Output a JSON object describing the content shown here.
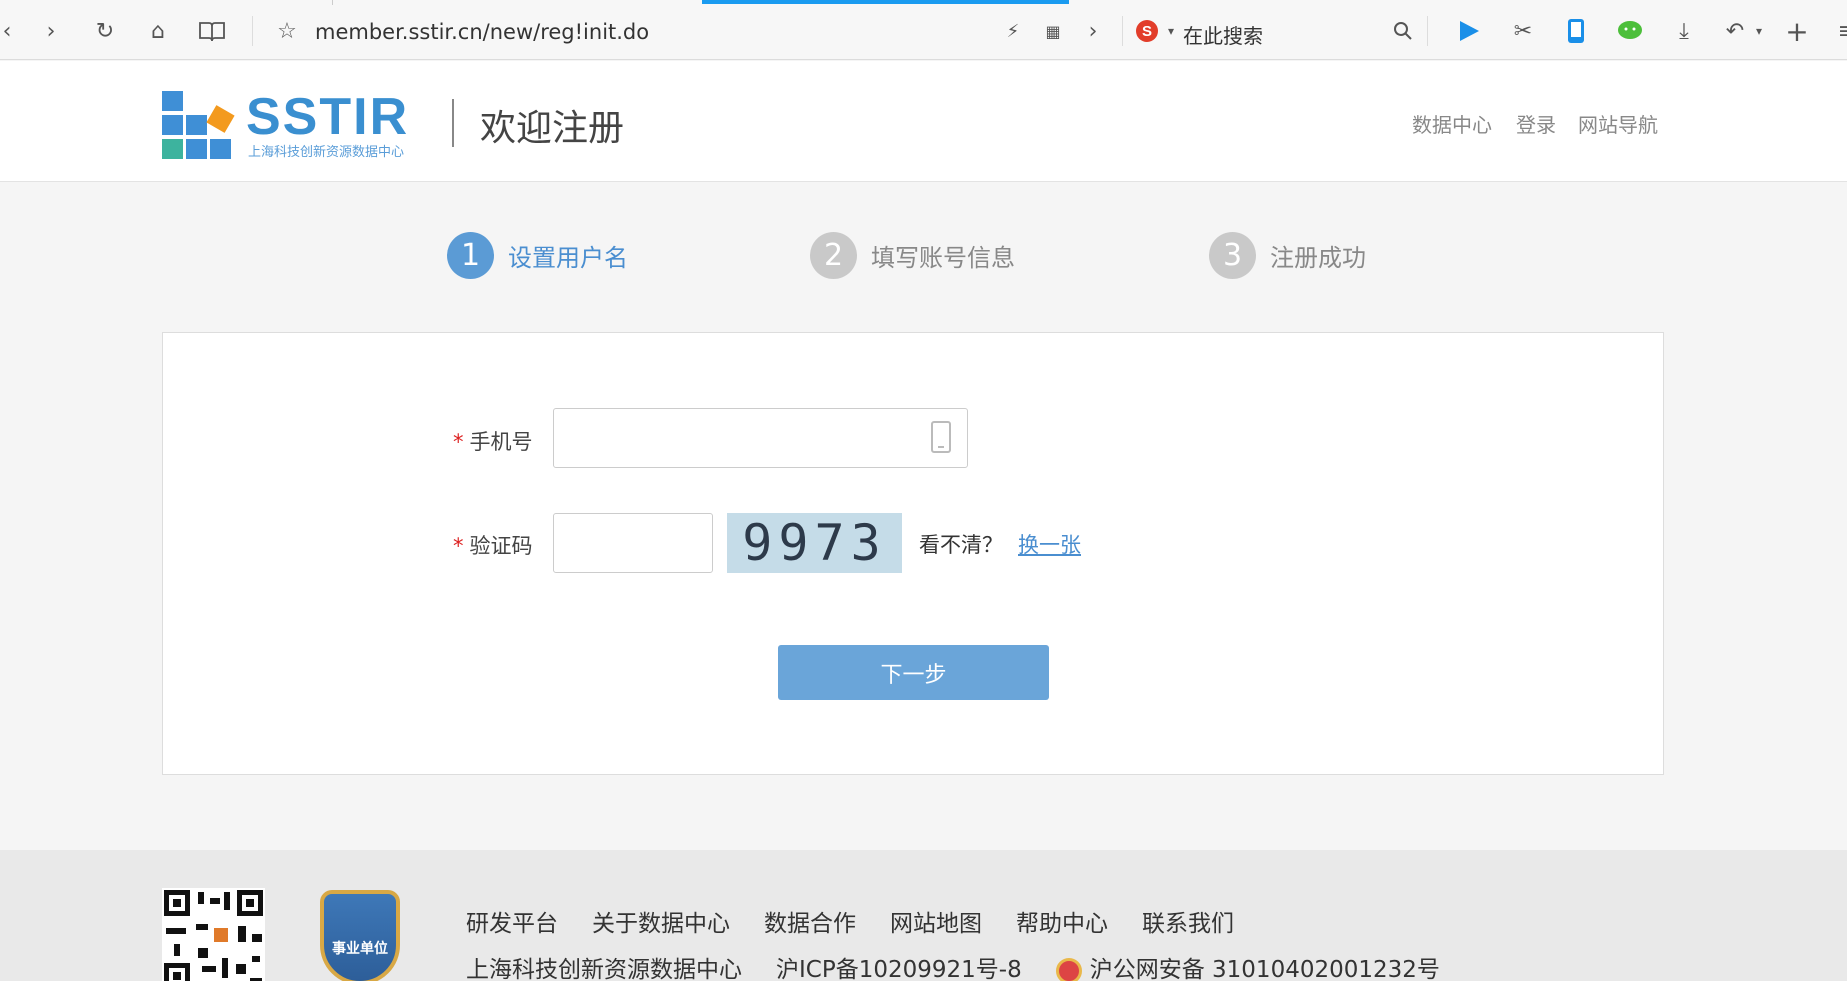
{
  "browser": {
    "url": "member.sstir.cn/new/reg!init.do",
    "search_placeholder": "在此搜索"
  },
  "header": {
    "brand": "SSTIR",
    "brand_subtitle": "上海科技创新资源数据中心",
    "title": "欢迎注册",
    "nav": [
      "数据中心",
      "登录",
      "网站导航"
    ]
  },
  "steps": [
    {
      "number": "1",
      "label": "设置用户名",
      "active": true
    },
    {
      "number": "2",
      "label": "填写账号信息",
      "active": false
    },
    {
      "number": "3",
      "label": "注册成功",
      "active": false
    }
  ],
  "form": {
    "phone_label": "手机号",
    "phone_value": "",
    "captcha_label": "验证码",
    "captcha_value": "",
    "captcha_code": "9973",
    "captcha_hint": "看不清？",
    "captcha_refresh": "换一张",
    "required_mark": "*",
    "next_button": "下一步"
  },
  "footer": {
    "links": [
      "研发平台",
      "关于数据中心",
      "数据合作",
      "网站地图",
      "帮助中心",
      "联系我们"
    ],
    "org_name": "上海科技创新资源数据中心",
    "icp": "沪ICP备10209921号-8",
    "police": "沪公网安备 31010402001232号",
    "badge_text": "事业单位"
  }
}
